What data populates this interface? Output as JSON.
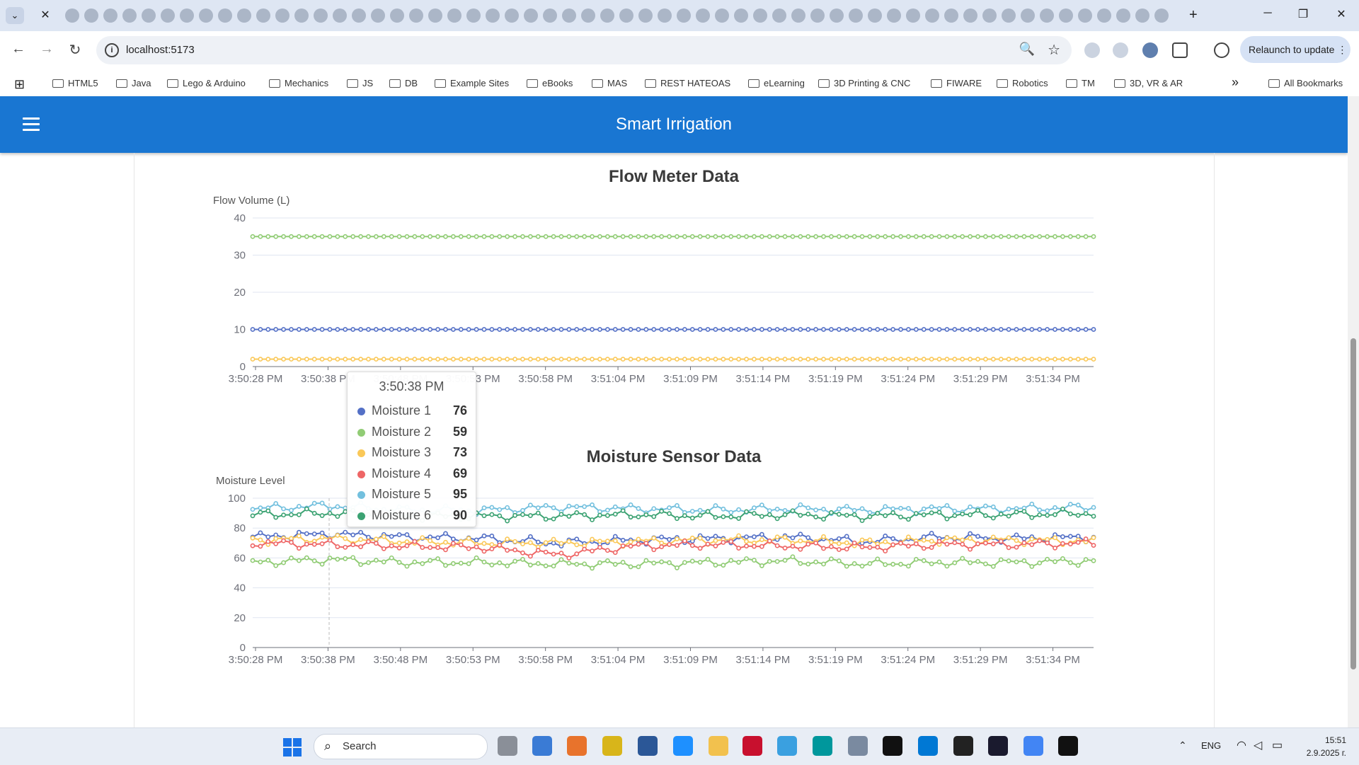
{
  "browser": {
    "url": "localhost:5173",
    "relaunch_label": "Relaunch to update",
    "bookmarks": [
      "HTML5",
      "Java",
      "Lego & Arduino",
      "Mechanics",
      "JS",
      "DB",
      "Example Sites",
      "eBooks",
      "MAS",
      "REST HATEOAS",
      "eLearning",
      "3D Printing & CNC",
      "FIWARE",
      "Robotics",
      "TM",
      "3D, VR & AR"
    ],
    "all_bookmarks_label": "All Bookmarks"
  },
  "app": {
    "title": "Smart Irrigation"
  },
  "flow_chart": {
    "title": "Flow Meter Data",
    "ylabel": "Flow Volume (L)",
    "y_ticks": [
      "40",
      "30",
      "20",
      "10",
      "0"
    ],
    "x_ticks": [
      "3:50:28 PM",
      "3:50:38 PM",
      "3:50:48 PM",
      "3:50:53 PM",
      "3:50:58 PM",
      "3:51:04 PM",
      "3:51:09 PM",
      "3:51:14 PM",
      "3:51:19 PM",
      "3:51:24 PM",
      "3:51:29 PM",
      "3:51:34 PM"
    ]
  },
  "moisture_chart": {
    "title": "Moisture Sensor Data",
    "ylabel": "Moisture Level",
    "y_ticks": [
      "100",
      "80",
      "60",
      "40",
      "20",
      "0"
    ],
    "x_ticks": [
      "3:50:28 PM",
      "3:50:38 PM",
      "3:50:48 PM",
      "3:50:53 PM",
      "3:50:58 PM",
      "3:51:04 PM",
      "3:51:09 PM",
      "3:51:14 PM",
      "3:51:19 PM",
      "3:51:24 PM",
      "3:51:29 PM",
      "3:51:34 PM"
    ]
  },
  "tooltip": {
    "title": "3:50:38 PM",
    "rows": [
      {
        "name": "Moisture 1",
        "value": "76",
        "color": "#5470c6"
      },
      {
        "name": "Moisture 2",
        "value": "59",
        "color": "#91cc75"
      },
      {
        "name": "Moisture 3",
        "value": "73",
        "color": "#fac858"
      },
      {
        "name": "Moisture 4",
        "value": "69",
        "color": "#ee6666"
      },
      {
        "name": "Moisture 5",
        "value": "95",
        "color": "#73c0de"
      },
      {
        "name": "Moisture 6",
        "value": "90",
        "color": "#3ba272"
      }
    ]
  },
  "chart_data": [
    {
      "type": "line",
      "title": "Flow Meter Data",
      "ylabel": "Flow Volume (L)",
      "xlabel": "",
      "ylim": [
        0,
        40
      ],
      "x": [
        "3:50:28 PM",
        "3:50:38 PM",
        "3:50:48 PM",
        "3:50:53 PM",
        "3:50:58 PM",
        "3:51:04 PM",
        "3:51:09 PM",
        "3:51:14 PM",
        "3:51:19 PM",
        "3:51:24 PM",
        "3:51:29 PM",
        "3:51:34 PM"
      ],
      "series": [
        {
          "color": "#5470c6",
          "values": [
            10,
            10,
            10,
            10,
            10,
            10,
            10,
            10,
            10,
            10,
            10,
            10
          ]
        },
        {
          "color": "#91cc75",
          "values": [
            35,
            35,
            35,
            35,
            35,
            35,
            35,
            35,
            35,
            35,
            35,
            35
          ]
        },
        {
          "color": "#fac858",
          "values": [
            2,
            2,
            2,
            2,
            2,
            2,
            2,
            2,
            2,
            2,
            2,
            2
          ]
        }
      ],
      "grid": true
    },
    {
      "type": "line",
      "title": "Moisture Sensor Data",
      "ylabel": "Moisture Level",
      "xlabel": "",
      "ylim": [
        0,
        100
      ],
      "x": [
        "3:50:28 PM",
        "3:50:38 PM",
        "3:50:48 PM",
        "3:50:53 PM",
        "3:50:58 PM",
        "3:51:04 PM",
        "3:51:09 PM",
        "3:51:14 PM",
        "3:51:19 PM",
        "3:51:24 PM",
        "3:51:29 PM",
        "3:51:34 PM"
      ],
      "series": [
        {
          "name": "Moisture 1",
          "color": "#5470c6",
          "values": [
            74,
            76,
            74,
            73,
            70,
            72,
            73,
            74,
            71,
            74,
            73,
            74
          ]
        },
        {
          "name": "Moisture 2",
          "color": "#91cc75",
          "values": [
            57,
            59,
            57,
            57,
            56,
            56,
            57,
            58,
            56,
            57,
            57,
            58
          ]
        },
        {
          "name": "Moisture 3",
          "color": "#fac858",
          "values": [
            72,
            73,
            71,
            70,
            70,
            71,
            72,
            72,
            70,
            72,
            72,
            71
          ]
        },
        {
          "name": "Moisture 4",
          "color": "#ee6666",
          "values": [
            70,
            69,
            68,
            67,
            62,
            68,
            69,
            68,
            67,
            69,
            69,
            70
          ]
        },
        {
          "name": "Moisture 5",
          "color": "#73c0de",
          "values": [
            93,
            95,
            92,
            92,
            94,
            93,
            92,
            93,
            92,
            93,
            93,
            94
          ]
        },
        {
          "name": "Moisture 6",
          "color": "#3ba272",
          "values": [
            89,
            90,
            88,
            88,
            88,
            89,
            88,
            89,
            88,
            89,
            89,
            90
          ]
        }
      ],
      "grid": true
    }
  ],
  "taskbar": {
    "search_placeholder": "Search",
    "lang": "ENG",
    "time": "15:51",
    "date": "2.9.2025 г."
  }
}
